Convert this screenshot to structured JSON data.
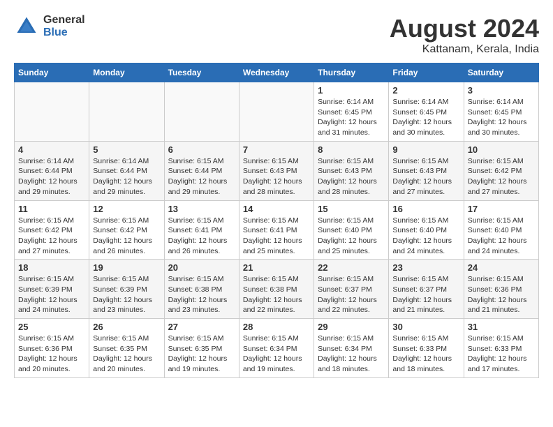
{
  "header": {
    "logo_general": "General",
    "logo_blue": "Blue",
    "title": "August 2024",
    "subtitle": "Kattanam, Kerala, India"
  },
  "days_of_week": [
    "Sunday",
    "Monday",
    "Tuesday",
    "Wednesday",
    "Thursday",
    "Friday",
    "Saturday"
  ],
  "weeks": [
    [
      {
        "num": "",
        "info": ""
      },
      {
        "num": "",
        "info": ""
      },
      {
        "num": "",
        "info": ""
      },
      {
        "num": "",
        "info": ""
      },
      {
        "num": "1",
        "info": "Sunrise: 6:14 AM\nSunset: 6:45 PM\nDaylight: 12 hours\nand 31 minutes."
      },
      {
        "num": "2",
        "info": "Sunrise: 6:14 AM\nSunset: 6:45 PM\nDaylight: 12 hours\nand 30 minutes."
      },
      {
        "num": "3",
        "info": "Sunrise: 6:14 AM\nSunset: 6:45 PM\nDaylight: 12 hours\nand 30 minutes."
      }
    ],
    [
      {
        "num": "4",
        "info": "Sunrise: 6:14 AM\nSunset: 6:44 PM\nDaylight: 12 hours\nand 29 minutes."
      },
      {
        "num": "5",
        "info": "Sunrise: 6:14 AM\nSunset: 6:44 PM\nDaylight: 12 hours\nand 29 minutes."
      },
      {
        "num": "6",
        "info": "Sunrise: 6:15 AM\nSunset: 6:44 PM\nDaylight: 12 hours\nand 29 minutes."
      },
      {
        "num": "7",
        "info": "Sunrise: 6:15 AM\nSunset: 6:43 PM\nDaylight: 12 hours\nand 28 minutes."
      },
      {
        "num": "8",
        "info": "Sunrise: 6:15 AM\nSunset: 6:43 PM\nDaylight: 12 hours\nand 28 minutes."
      },
      {
        "num": "9",
        "info": "Sunrise: 6:15 AM\nSunset: 6:43 PM\nDaylight: 12 hours\nand 27 minutes."
      },
      {
        "num": "10",
        "info": "Sunrise: 6:15 AM\nSunset: 6:42 PM\nDaylight: 12 hours\nand 27 minutes."
      }
    ],
    [
      {
        "num": "11",
        "info": "Sunrise: 6:15 AM\nSunset: 6:42 PM\nDaylight: 12 hours\nand 27 minutes."
      },
      {
        "num": "12",
        "info": "Sunrise: 6:15 AM\nSunset: 6:42 PM\nDaylight: 12 hours\nand 26 minutes."
      },
      {
        "num": "13",
        "info": "Sunrise: 6:15 AM\nSunset: 6:41 PM\nDaylight: 12 hours\nand 26 minutes."
      },
      {
        "num": "14",
        "info": "Sunrise: 6:15 AM\nSunset: 6:41 PM\nDaylight: 12 hours\nand 25 minutes."
      },
      {
        "num": "15",
        "info": "Sunrise: 6:15 AM\nSunset: 6:40 PM\nDaylight: 12 hours\nand 25 minutes."
      },
      {
        "num": "16",
        "info": "Sunrise: 6:15 AM\nSunset: 6:40 PM\nDaylight: 12 hours\nand 24 minutes."
      },
      {
        "num": "17",
        "info": "Sunrise: 6:15 AM\nSunset: 6:40 PM\nDaylight: 12 hours\nand 24 minutes."
      }
    ],
    [
      {
        "num": "18",
        "info": "Sunrise: 6:15 AM\nSunset: 6:39 PM\nDaylight: 12 hours\nand 24 minutes."
      },
      {
        "num": "19",
        "info": "Sunrise: 6:15 AM\nSunset: 6:39 PM\nDaylight: 12 hours\nand 23 minutes."
      },
      {
        "num": "20",
        "info": "Sunrise: 6:15 AM\nSunset: 6:38 PM\nDaylight: 12 hours\nand 23 minutes."
      },
      {
        "num": "21",
        "info": "Sunrise: 6:15 AM\nSunset: 6:38 PM\nDaylight: 12 hours\nand 22 minutes."
      },
      {
        "num": "22",
        "info": "Sunrise: 6:15 AM\nSunset: 6:37 PM\nDaylight: 12 hours\nand 22 minutes."
      },
      {
        "num": "23",
        "info": "Sunrise: 6:15 AM\nSunset: 6:37 PM\nDaylight: 12 hours\nand 21 minutes."
      },
      {
        "num": "24",
        "info": "Sunrise: 6:15 AM\nSunset: 6:36 PM\nDaylight: 12 hours\nand 21 minutes."
      }
    ],
    [
      {
        "num": "25",
        "info": "Sunrise: 6:15 AM\nSunset: 6:36 PM\nDaylight: 12 hours\nand 20 minutes."
      },
      {
        "num": "26",
        "info": "Sunrise: 6:15 AM\nSunset: 6:35 PM\nDaylight: 12 hours\nand 20 minutes."
      },
      {
        "num": "27",
        "info": "Sunrise: 6:15 AM\nSunset: 6:35 PM\nDaylight: 12 hours\nand 19 minutes."
      },
      {
        "num": "28",
        "info": "Sunrise: 6:15 AM\nSunset: 6:34 PM\nDaylight: 12 hours\nand 19 minutes."
      },
      {
        "num": "29",
        "info": "Sunrise: 6:15 AM\nSunset: 6:34 PM\nDaylight: 12 hours\nand 18 minutes."
      },
      {
        "num": "30",
        "info": "Sunrise: 6:15 AM\nSunset: 6:33 PM\nDaylight: 12 hours\nand 18 minutes."
      },
      {
        "num": "31",
        "info": "Sunrise: 6:15 AM\nSunset: 6:33 PM\nDaylight: 12 hours\nand 17 minutes."
      }
    ]
  ]
}
